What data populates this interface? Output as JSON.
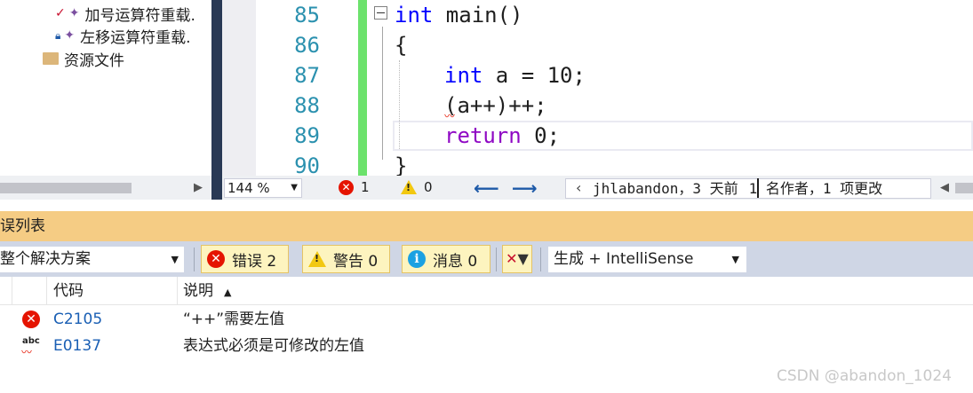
{
  "solution_explorer": {
    "items": [
      {
        "label": "加号运算符重载.",
        "state_icon": "check-icon"
      },
      {
        "label": "左移运算符重载.",
        "state_icon": "lock-icon"
      },
      {
        "label": "资源文件"
      }
    ]
  },
  "editor": {
    "lines": [
      {
        "number": "85"
      },
      {
        "number": "86"
      },
      {
        "number": "87"
      },
      {
        "number": "88"
      },
      {
        "number": "89"
      },
      {
        "number": "90"
      }
    ],
    "code": {
      "l85_kw": "int",
      "l85_rest": " main()",
      "l86": "{",
      "l87_kw": "int",
      "l87_rest": " a = 10;",
      "l88": "(a++)++;",
      "l89_kw": "return",
      "l89_rest": " 0;",
      "l90": "}"
    },
    "status": {
      "zoom": "144 %",
      "errors": "1",
      "warnings": "0",
      "blame_author": "jhlabandon，3 天前",
      "blame_summary": "1 名作者，1 项更改"
    }
  },
  "error_list": {
    "title": "误列表",
    "scope": "整个解决方案",
    "filters": {
      "errors": "错误 2",
      "warnings": "警告 0",
      "messages": "消息 0"
    },
    "build_source": "生成 + IntelliSense",
    "columns": {
      "code": "代码",
      "description": "说明"
    },
    "rows": [
      {
        "icon": "error-icon",
        "code": "C2105",
        "description": "“++”需要左值"
      },
      {
        "icon": "intellisense-abc-icon",
        "code": "E0137",
        "description": "表达式必须是可修改的左值"
      }
    ]
  },
  "watermark": "CSDN @abandon_1024"
}
